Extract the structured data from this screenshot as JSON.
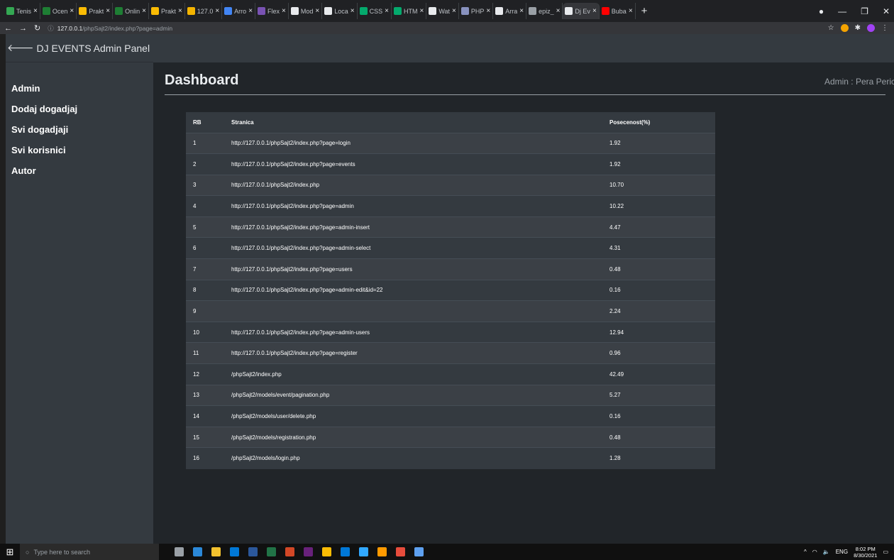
{
  "browser": {
    "tabs": [
      {
        "title": "Tenis",
        "color": "#34a853"
      },
      {
        "title": "Ocen",
        "color": "#1e7e34"
      },
      {
        "title": "Prakt",
        "color": "#fbbc04"
      },
      {
        "title": "Onlin",
        "color": "#1e7e34"
      },
      {
        "title": "Prakt",
        "color": "#fbbc04"
      },
      {
        "title": "127.0",
        "color": "#f4b400"
      },
      {
        "title": "Arro",
        "color": "#4285f4"
      },
      {
        "title": "Flex",
        "color": "#7952b3"
      },
      {
        "title": "Mod",
        "color": "#e8eaed"
      },
      {
        "title": "Loca",
        "color": "#e8eaed"
      },
      {
        "title": "CSS",
        "color": "#04aa6d"
      },
      {
        "title": "HTM",
        "color": "#04aa6d"
      },
      {
        "title": "Wat",
        "color": "#e8eaed"
      },
      {
        "title": "PHP",
        "color": "#8892bf"
      },
      {
        "title": "Arra",
        "color": "#e8eaed"
      },
      {
        "title": "epiz_",
        "color": "#9aa0a6"
      },
      {
        "title": "Dj Ev",
        "color": "#e8eaed",
        "active": true
      },
      {
        "title": "Buba",
        "color": "#ff0000"
      }
    ],
    "new_tab": "+",
    "url_host": "127.0.0.1",
    "url_path": "/phpSajt2/index.php?page=admin"
  },
  "sidebar": {
    "brand": "DJ EVENTS Admin Panel",
    "items": [
      "Admin",
      "Dodaj dogadjaj",
      "Svi dogadjaji",
      "Svi korisnici",
      "Autor"
    ]
  },
  "main": {
    "title": "Dashboard",
    "admin_label": "Admin : Pera Peric",
    "table": {
      "headers": [
        "RB",
        "Stranica",
        "Posecenost(%)"
      ],
      "rows": [
        [
          "1",
          "http://127.0.0.1/phpSajt2/index.php?page=login",
          "1.92"
        ],
        [
          "2",
          "http://127.0.0.1/phpSajt2/index.php?page=events",
          "1.92"
        ],
        [
          "3",
          "http://127.0.0.1/phpSajt2/index.php",
          "10.70"
        ],
        [
          "4",
          "http://127.0.0.1/phpSajt2/index.php?page=admin",
          "10.22"
        ],
        [
          "5",
          "http://127.0.0.1/phpSajt2/index.php?page=admin-insert",
          "4.47"
        ],
        [
          "6",
          "http://127.0.0.1/phpSajt2/index.php?page=admin-select",
          "4.31"
        ],
        [
          "7",
          "http://127.0.0.1/phpSajt2/index.php?page=users",
          "0.48"
        ],
        [
          "8",
          "http://127.0.0.1/phpSajt2/index.php?page=admin-edit&id=22",
          "0.16"
        ],
        [
          "9",
          "",
          "2.24"
        ],
        [
          "10",
          "http://127.0.0.1/phpSajt2/index.php?page=admin-users",
          "12.94"
        ],
        [
          "11",
          "http://127.0.0.1/phpSajt2/index.php?page=register",
          "0.96"
        ],
        [
          "12",
          "/phpSajt2/index.php",
          "42.49"
        ],
        [
          "13",
          "/phpSajt2/models/event/pagination.php",
          "5.27"
        ],
        [
          "14",
          "/phpSajt2/models/user/delete.php",
          "0.16"
        ],
        [
          "15",
          "/phpSajt2/models/registration.php",
          "0.48"
        ],
        [
          "16",
          "/phpSajt2/models/login.php",
          "1.28"
        ]
      ]
    }
  },
  "taskbar": {
    "search_placeholder": "Type here to search",
    "apps": [
      "#9aa0a6",
      "#2b88d8",
      "#f2c12e",
      "#0078d7",
      "#2b579a",
      "#217346",
      "#d24726",
      "#68217a",
      "#fbbc04",
      "#0078d7",
      "#31a8ff",
      "#ff9a00",
      "#e74c3c",
      "#5ea0ef"
    ],
    "language": "ENG",
    "time": "8:02 PM",
    "date": "8/30/2021"
  }
}
